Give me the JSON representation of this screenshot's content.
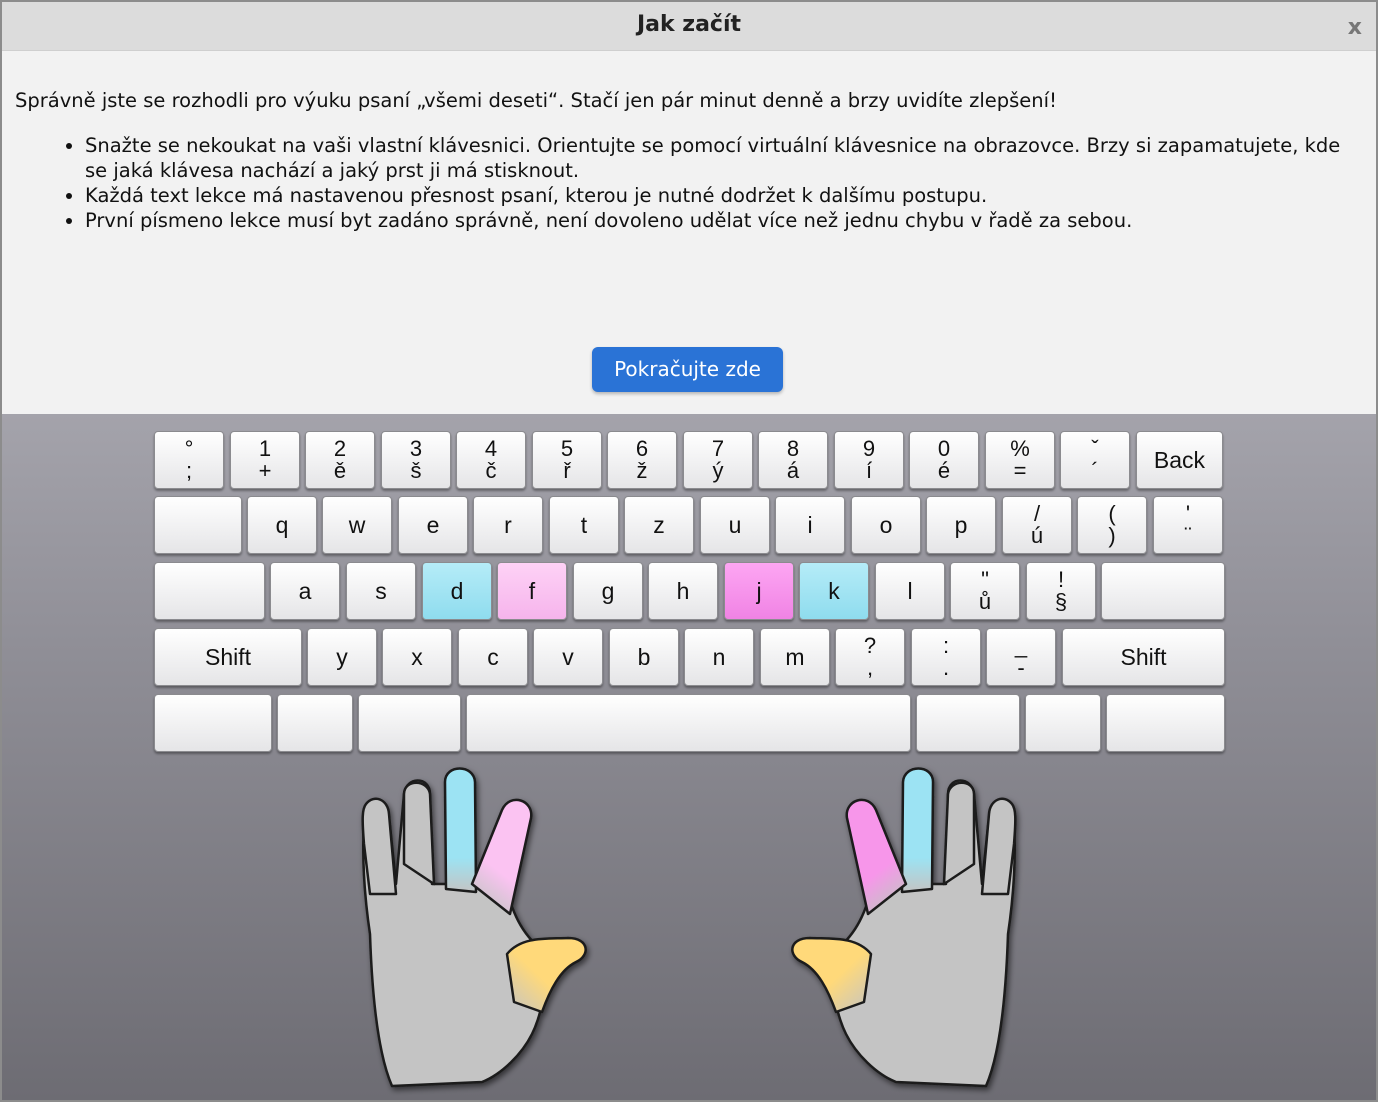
{
  "dialog": {
    "title": "Jak začít",
    "close_label": "x",
    "intro": "Správně jste se rozhodli pro výuku psaní „všemi deseti“. Stačí jen pár minut denně a brzy uvidíte zlepšení!",
    "bullets": [
      "Snažte se nekoukat na vaši vlastní klávesnici. Orientujte se pomocí virtuální klávesnice na obrazovce. Brzy si zapamatujete, kde se jaká klávesa nachází a jaký prst ji má stisknout.",
      "Každá text lekce má nastavenou přesnost psaní, kterou je nutné dodržet k dalšímu postupu.",
      "První písmeno lekce musí byt zadáno správně, není dovoleno udělat více než jednu chybu v řadě za sebou."
    ],
    "continue_button": "Pokračujte zde"
  },
  "keyboard": {
    "rows": [
      [
        {
          "top": "°",
          "bot": ";"
        },
        {
          "top": "1",
          "bot": "+"
        },
        {
          "top": "2",
          "bot": "ě"
        },
        {
          "top": "3",
          "bot": "š"
        },
        {
          "top": "4",
          "bot": "č"
        },
        {
          "top": "5",
          "bot": "ř"
        },
        {
          "top": "6",
          "bot": "ž"
        },
        {
          "top": "7",
          "bot": "ý"
        },
        {
          "top": "8",
          "bot": "á"
        },
        {
          "top": "9",
          "bot": "í"
        },
        {
          "top": "0",
          "bot": "é"
        },
        {
          "top": "%",
          "bot": "="
        },
        {
          "top": "ˇ",
          "bot": "´"
        },
        {
          "label": "Back"
        }
      ],
      [
        {
          "label": ""
        },
        {
          "label": "q"
        },
        {
          "label": "w"
        },
        {
          "label": "e"
        },
        {
          "label": "r"
        },
        {
          "label": "t"
        },
        {
          "label": "z"
        },
        {
          "label": "u"
        },
        {
          "label": "i"
        },
        {
          "label": "o"
        },
        {
          "label": "p"
        },
        {
          "top": "/",
          "bot": "ú"
        },
        {
          "top": "(",
          "bot": ")"
        },
        {
          "top": "'",
          "bot": "¨"
        }
      ],
      [
        {
          "label": ""
        },
        {
          "label": "a"
        },
        {
          "label": "s"
        },
        {
          "label": "d",
          "color": "cyan"
        },
        {
          "label": "f",
          "color": "pink"
        },
        {
          "label": "g"
        },
        {
          "label": "h"
        },
        {
          "label": "j",
          "color": "magenta"
        },
        {
          "label": "k",
          "color": "cyan"
        },
        {
          "label": "l"
        },
        {
          "top": "\"",
          "bot": "ů"
        },
        {
          "top": "!",
          "bot": "§"
        },
        {
          "label": ""
        }
      ],
      [
        {
          "label": "Shift"
        },
        {
          "label": "y"
        },
        {
          "label": "x"
        },
        {
          "label": "c"
        },
        {
          "label": "v"
        },
        {
          "label": "b"
        },
        {
          "label": "n"
        },
        {
          "label": "m"
        },
        {
          "top": "?",
          "bot": ","
        },
        {
          "top": ":",
          "bot": "."
        },
        {
          "top": "_",
          "bot": "-"
        },
        {
          "label": "Shift"
        }
      ],
      [
        {
          "label": ""
        },
        {
          "label": ""
        },
        {
          "label": ""
        },
        {
          "label": ""
        },
        {
          "label": ""
        },
        {
          "label": ""
        },
        {
          "label": ""
        }
      ]
    ]
  },
  "colors": {
    "cyan": "#9ce3f3",
    "pink": "#fbc3f2",
    "magenta": "#f796ea",
    "thumb": "#ffd97a",
    "palm": "#c4c4c4",
    "button": "#2a73d6"
  }
}
